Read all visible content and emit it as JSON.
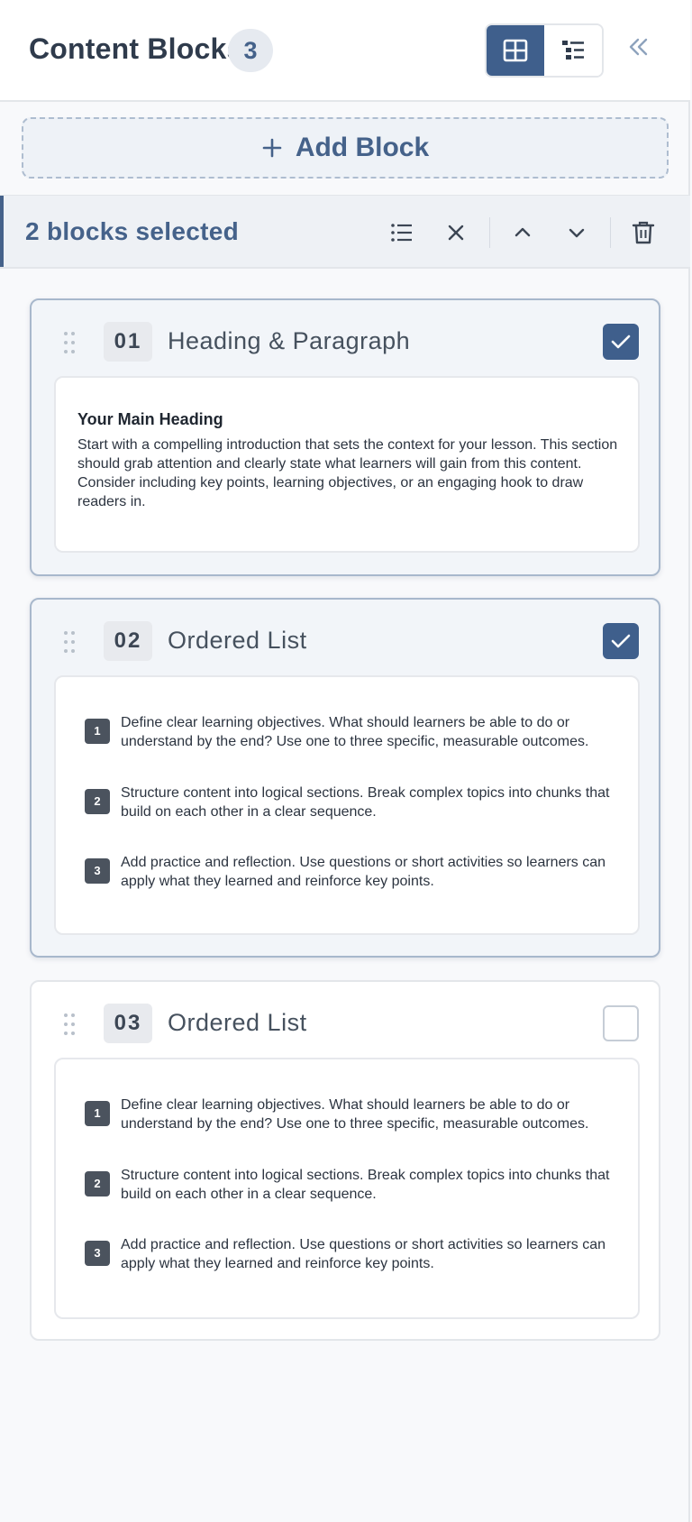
{
  "header": {
    "title": "Content Blocks",
    "count": "3",
    "icons": {
      "grid_view": "grid-view-icon",
      "list_view": "list-view-icon",
      "collapse": "double-chevron-left-icon"
    }
  },
  "add_block": {
    "label": "Add Block",
    "icon": "plus-icon"
  },
  "selection_bar": {
    "text": "2 blocks selected",
    "icons": [
      "select-all-list-icon",
      "close-icon",
      "chevron-up-icon",
      "chevron-down-icon",
      "trash-icon"
    ]
  },
  "colors": {
    "accent": "#45628a",
    "accent_dark": "#3f5f8c",
    "border": "#e3e6ea"
  },
  "blocks": [
    {
      "number": "01",
      "title": "Heading & Paragraph",
      "checked": true,
      "heading": "Your Main Heading",
      "paragraph": "Start with a compelling introduction that sets the context for your lesson. This section should grab attention and clearly state what learners will gain from this content. Consider including key points, learning objectives, or an engaging hook to draw readers in."
    },
    {
      "number": "02",
      "title": "Ordered List",
      "checked": true,
      "items": [
        {
          "n": "1",
          "text": "Define clear learning objectives. What should learners be able to do or understand by the end? Use one to three specific, measurable outcomes."
        },
        {
          "n": "2",
          "text": "Structure content into logical sections. Break complex topics into chunks that build on each other in a clear sequence."
        },
        {
          "n": "3",
          "text": "Add practice and reflection. Use questions or short activities so learners can apply what they learned and reinforce key points."
        }
      ]
    },
    {
      "number": "03",
      "title": "Ordered List",
      "checked": false,
      "items": [
        {
          "n": "1",
          "text": "Define clear learning objectives. What should learners be able to do or understand by the end? Use one to three specific, measurable outcomes."
        },
        {
          "n": "2",
          "text": "Structure content into logical sections. Break complex topics into chunks that build on each other in a clear sequence."
        },
        {
          "n": "3",
          "text": "Add practice and reflection. Use questions or short activities so learners can apply what they learned and reinforce key points."
        }
      ]
    }
  ]
}
